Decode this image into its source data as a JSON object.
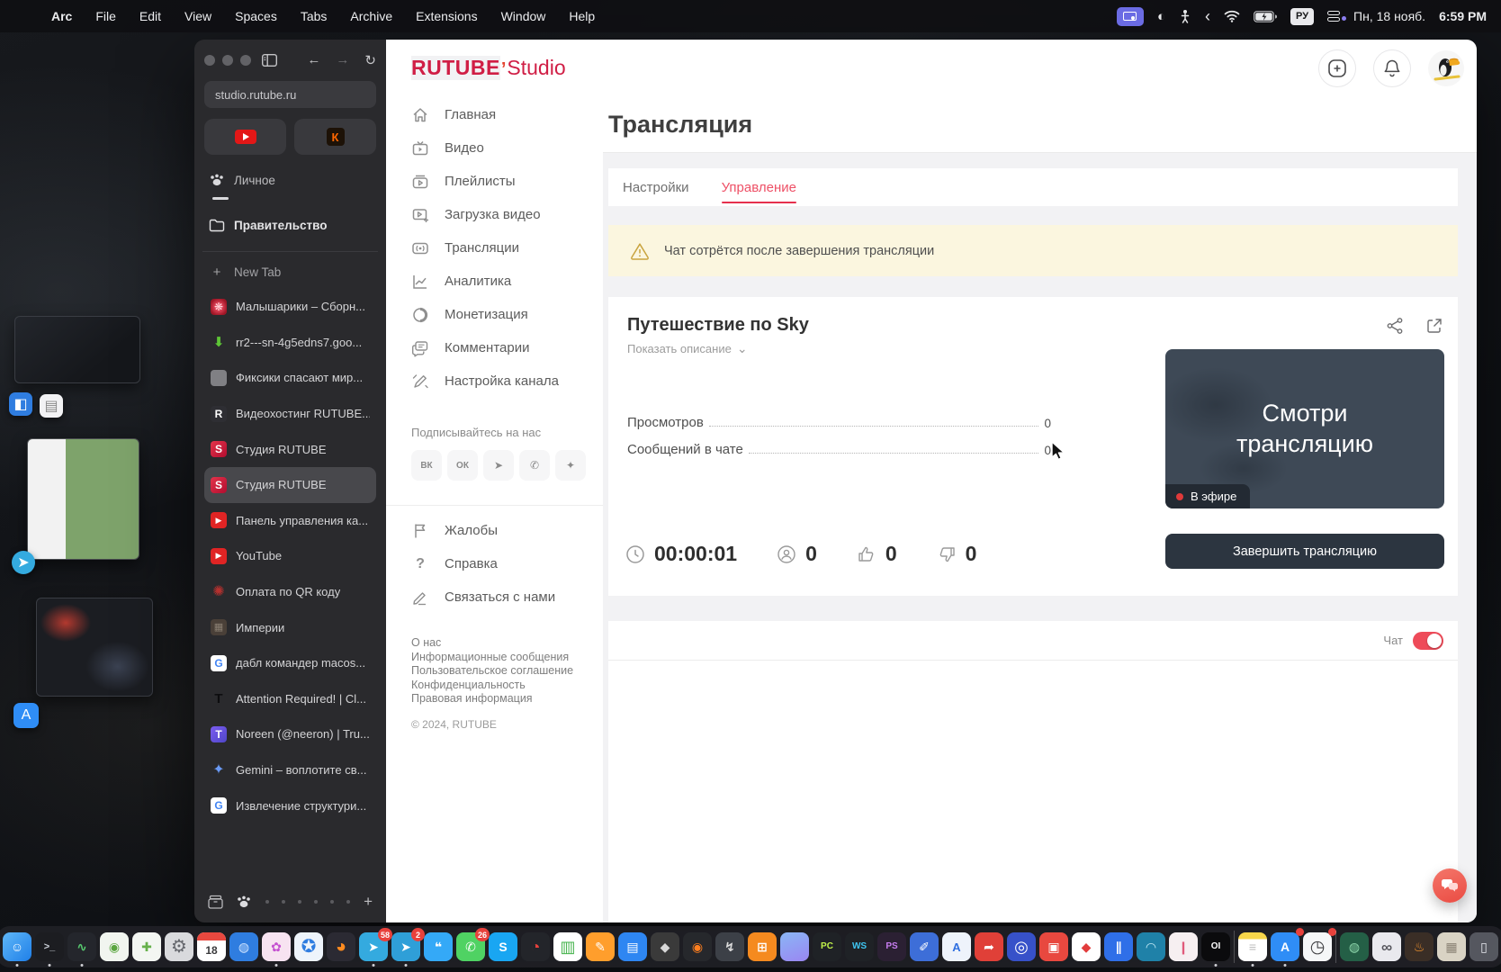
{
  "icons": {
    "plus": "+",
    "back": "←",
    "forward": "→",
    "reload": "↻",
    "chevron_down": "⌄",
    "chevron_left": "‹",
    "contrast": "◐"
  },
  "menu_bar": {
    "items": [
      {
        "label": "Arc",
        "bold": true
      },
      {
        "label": "File"
      },
      {
        "label": "Edit"
      },
      {
        "label": "View"
      },
      {
        "label": "Spaces"
      },
      {
        "label": "Tabs"
      },
      {
        "label": "Archive"
      },
      {
        "label": "Extensions"
      },
      {
        "label": "Window"
      },
      {
        "label": "Help"
      }
    ],
    "status": {
      "lang_badge": "РУ",
      "date": "Пн, 18 нояб.",
      "time": "6:59 PM"
    }
  },
  "arc": {
    "url": "studio.rutube.ru",
    "space_personal": "Личное",
    "space_gov": "Правительство",
    "new_tab": "New Tab",
    "tabs": [
      {
        "title": "Малышарики – Сборн...",
        "bg": "radial-gradient(circle,#e8495f 25%,#a01626 75%)",
        "fg": "#ffd9dd",
        "glyph": "❋"
      },
      {
        "title": "rr2---sn-4g5edns7.goo...",
        "bg": "transparent",
        "fg": "#5ec636",
        "glyph": "⬇",
        "fs": "15px"
      },
      {
        "title": "Фиксики спасают мир...",
        "bg": "#808084",
        "fg": "#808084",
        "glyph": ""
      },
      {
        "title": "Видеохостинг RUTUBE...",
        "bg": "#2e2e33",
        "fg": "#fff",
        "glyph": "R"
      },
      {
        "title": "Студия RUTUBE",
        "bg": "linear-gradient(135deg,#e4334b,#b10d2f)",
        "fg": "#fff",
        "glyph": "S"
      },
      {
        "title": "Студия RUTUBE",
        "bg": "linear-gradient(135deg,#e4334b,#b10d2f)",
        "fg": "#fff",
        "glyph": "S",
        "selected": true
      },
      {
        "title": "Панель управления ка...",
        "bg": "#e02424",
        "fg": "#fff",
        "glyph": "▶",
        "fs": "9px"
      },
      {
        "title": "YouTube",
        "bg": "#e02424",
        "fg": "#fff",
        "glyph": "▶",
        "fs": "9px"
      },
      {
        "title": "Оплата по QR коду",
        "bg": "transparent",
        "fg": "#b5312f",
        "glyph": "✺",
        "fs": "16px"
      },
      {
        "title": "Империи",
        "bg": "#4a4038",
        "fg": "#8a7f72",
        "glyph": "▦",
        "fs": "11px"
      },
      {
        "title": "дабл командер macos...",
        "bg": "#ffffff",
        "fg": "#4285f4",
        "glyph": "G"
      },
      {
        "title": "Attention Required! | Cl...",
        "bg": "transparent",
        "fg": "#0d0d0f",
        "glyph": "T",
        "fs": "15px"
      },
      {
        "title": "Noreen (@neeron) | Tru...",
        "bg": "linear-gradient(135deg,#7b5cf0,#4f46c8)",
        "fg": "#fff",
        "glyph": "T"
      },
      {
        "title": "Gemini – воплотите св...",
        "bg": "transparent",
        "fg": "#6a9af6",
        "glyph": "✦",
        "fs": "16px"
      },
      {
        "title": "Извлечение структури...",
        "bg": "#ffffff",
        "fg": "#4285f4",
        "glyph": "G"
      }
    ]
  },
  "studio": {
    "logo": {
      "main": "RUTUBE",
      "mark": "’",
      "sub": "Studio"
    },
    "nav": [
      "Главная",
      "Видео",
      "Плейлисты",
      "Загрузка видео",
      "Трансляции",
      "Аналитика",
      "Монетизация",
      "Комментарии",
      "Настройка канала"
    ],
    "subscribe_label": "Подписывайтесь на нас",
    "social": [
      {
        "glyph": "ВК"
      },
      {
        "glyph": "ОК"
      },
      {
        "glyph": "➤"
      },
      {
        "glyph": "✆"
      },
      {
        "glyph": "✦"
      }
    ],
    "secondary": [
      "Жалобы",
      "Справка",
      "Связаться с нами"
    ],
    "footer_links": [
      "О нас",
      "Информационные сообщения",
      "Пользовательское соглашение",
      "Конфиденциальность",
      "Правовая информация"
    ],
    "copyright": "© 2024, RUTUBE"
  },
  "page": {
    "title": "Трансляция",
    "tabs": [
      {
        "label": "Настройки"
      },
      {
        "label": "Управление",
        "active": true
      }
    ],
    "warning": "Чат сотрётся после завершения трансляции",
    "stream": {
      "title": "Путешествие по Sky",
      "show_description": "Показать описание",
      "stats": [
        {
          "label": "Просмотров",
          "value": "0"
        },
        {
          "label": "Сообщений в чате",
          "value": "0"
        }
      ],
      "timer": "00:00:01",
      "viewers": "0",
      "likes": "0",
      "dislikes": "0",
      "preview_text": "Смотри трансляцию",
      "live_badge": "В эфире",
      "end_button": "Завершить трансляцию"
    },
    "chat_label": "Чат"
  },
  "colors": {
    "accent_red": "#d01e45",
    "tab_active": "#ee5066",
    "toggle_on": "#ee4b59",
    "warning_bg": "#fbf6df",
    "live_dot": "#e03a3a"
  },
  "dock": {
    "items": [
      {
        "name": "finder",
        "bg": "linear-gradient(135deg,#5fb7f8,#1f7fe8)",
        "glyph": "☺",
        "fg": "#fff",
        "running": true
      },
      {
        "name": "terminal",
        "bg": "#1c1d21",
        "glyph": ">_",
        "fg": "#cdd2da",
        "fs": "11px",
        "running": true
      },
      {
        "name": "activity-monitor",
        "bg": "#24262c",
        "glyph": "∿",
        "fg": "#57c96e",
        "running": true
      },
      {
        "name": "green-utility",
        "bg": "#f1f5ef",
        "glyph": "◉",
        "fg": "#5aa63f"
      },
      {
        "name": "adguard",
        "bg": "#f3f6f2",
        "glyph": "✚",
        "fg": "#66b04b"
      },
      {
        "name": "system-settings",
        "bg": "#d9dadd",
        "glyph": "⚙",
        "fg": "#66686e",
        "fs": "20px"
      },
      {
        "name": "calendar",
        "bg": "#ffffff",
        "glyph": "18",
        "fg": "#3a3a3c",
        "fs": "12px",
        "cal": true
      },
      {
        "name": "blue-round-app",
        "bg": "#2f7de0",
        "glyph": "◍",
        "fg": "#cfe4ff"
      },
      {
        "name": "pink-brush-app",
        "bg": "#f7e3f1",
        "glyph": "✿",
        "fg": "#c44fd0",
        "running": true
      },
      {
        "name": "safari",
        "bg": "#eef4fb",
        "glyph": "✪",
        "fg": "#2f7de0",
        "fs": "20px"
      },
      {
        "name": "firefox",
        "bg": "#2b2a33",
        "glyph": "◕",
        "fg": "#ff8b1f",
        "fs": "20px"
      },
      {
        "name": "telegram",
        "bg": "#34aadf",
        "glyph": "➤",
        "fg": "#fff",
        "badge": "58",
        "running": true
      },
      {
        "name": "telegram-2",
        "bg": "#2f9fd8",
        "glyph": "➤",
        "fg": "#fff",
        "badge": "2",
        "running": true
      },
      {
        "name": "messages",
        "bg": "#34a9f7",
        "glyph": "❝",
        "fg": "#fff"
      },
      {
        "name": "whatsapp",
        "bg": "#4fd263",
        "glyph": "✆",
        "fg": "#fff",
        "badge": "26"
      },
      {
        "name": "skype",
        "bg": "#19a6f2",
        "glyph": "S",
        "fg": "#fff"
      },
      {
        "name": "red-dial-app",
        "bg": "#23252a",
        "glyph": "◔",
        "fg": "#e8413c",
        "fs": "18px"
      },
      {
        "name": "chart-app",
        "bg": "#ffffff",
        "glyph": "▥",
        "fg": "#44b34c",
        "fs": "18px"
      },
      {
        "name": "pages",
        "bg": "#ff9e2c",
        "glyph": "✎",
        "fg": "#fff"
      },
      {
        "name": "keynote",
        "bg": "#2e86f2",
        "glyph": "▤",
        "fg": "#fff"
      },
      {
        "name": "inkscape",
        "bg": "#3a3a3a",
        "glyph": "◆",
        "fg": "#d8d8d8"
      },
      {
        "name": "blender",
        "bg": "#26282c",
        "glyph": "◉",
        "fg": "#ff7f1f"
      },
      {
        "name": "wand-app",
        "bg": "#3c4047",
        "glyph": "↯",
        "fg": "#dcdcdc"
      },
      {
        "name": "org-chart-app",
        "bg": "#f58a1f",
        "glyph": "⊞",
        "fg": "#fff"
      },
      {
        "name": "gradient-app",
        "bg": "linear-gradient(160deg,#8ab6f5,#9a86f2)",
        "glyph": "",
        "fg": "#fff"
      },
      {
        "name": "pycharm",
        "bg": "#1f2226",
        "glyph": "PC",
        "fg": "#c0f24a",
        "fs": "10px"
      },
      {
        "name": "webstorm",
        "bg": "#1f2226",
        "glyph": "WS",
        "fg": "#3fc6f2",
        "fs": "10px"
      },
      {
        "name": "phpstorm",
        "bg": "#2b2033",
        "glyph": "PS",
        "fg": "#c77df0",
        "fs": "10px"
      },
      {
        "name": "code-pencil-app",
        "bg": "#3d6ed8",
        "glyph": "✐",
        "fg": "#fff"
      },
      {
        "name": "appcode",
        "bg": "#eef3fb",
        "glyph": "A",
        "fg": "#2f6fe0",
        "fs": "13px"
      },
      {
        "name": "share-red-app",
        "bg": "#e04038",
        "glyph": "➦",
        "fg": "#fff"
      },
      {
        "name": "target-blue-app",
        "bg": "#3751c9",
        "glyph": "◎",
        "fg": "#fff",
        "fs": "18px"
      },
      {
        "name": "red-square-app",
        "bg": "#e8483f",
        "glyph": "▣",
        "fg": "#fff"
      },
      {
        "name": "ruby-app",
        "bg": "#ffffff",
        "glyph": "◆",
        "fg": "#e23c3c"
      },
      {
        "name": "parallels",
        "bg": "#2f6fe8",
        "glyph": "∥",
        "fg": "#fff"
      },
      {
        "name": "swirl-teal-app",
        "bg": "#1f81a8",
        "glyph": "◠",
        "fg": "#c6ecf7"
      },
      {
        "name": "stripe-pink-app",
        "bg": "#f6eff1",
        "glyph": "❙",
        "fg": "#e05a7a"
      },
      {
        "name": "oi-dark-app",
        "bg": "#0b0b0d",
        "glyph": "OI",
        "fg": "#fff",
        "fs": "10px",
        "running": true
      },
      {
        "sep": true
      },
      {
        "name": "notes",
        "bg": "linear-gradient(180deg,#f7d64a 0%,#f7d64a 24%,#ffffff 24%)",
        "glyph": "≡",
        "fg": "#bdbdbd",
        "running": true
      },
      {
        "name": "app-store",
        "bg": "#2f8df6",
        "glyph": "A",
        "fg": "#fff",
        "badge_dot": true,
        "running": true
      },
      {
        "name": "screen-time",
        "bg": "#f6f7f8",
        "glyph": "◷",
        "fg": "#3d3d40",
        "fs": "19px",
        "badge_dot": true
      },
      {
        "sep": true
      },
      {
        "name": "earth-game",
        "bg": "#245f46",
        "glyph": "◍",
        "fg": "#8fd8ad"
      },
      {
        "name": "binoculars-app",
        "bg": "#e9e9ee",
        "glyph": "∞",
        "fg": "#55555c",
        "fs": "17px"
      },
      {
        "name": "lamp-app",
        "bg": "#3a2e26",
        "glyph": "♨",
        "fg": "#ff9a2e"
      },
      {
        "name": "archive-box",
        "bg": "#d9d3c4",
        "glyph": "▦",
        "fg": "#8a8274"
      },
      {
        "name": "trash",
        "bg": "rgba(190,195,205,0.35)",
        "glyph": "▯",
        "fg": "#e6e8ee"
      }
    ]
  }
}
